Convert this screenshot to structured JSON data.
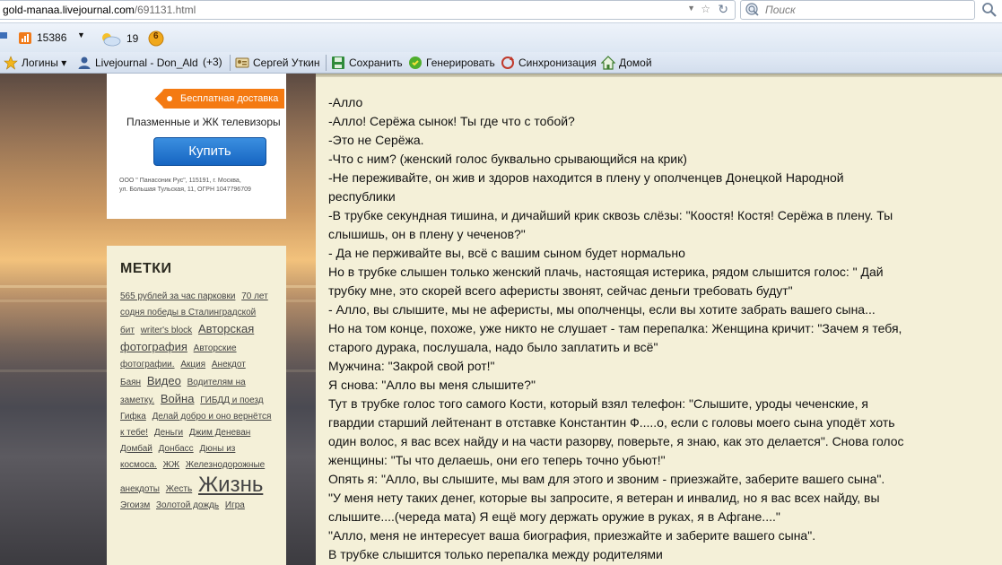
{
  "browser": {
    "url_host": "gold-manaa.livejournal.com",
    "url_path": "/691131.html",
    "search_placeholder": "Поиск"
  },
  "addons": {
    "rating": "15386",
    "weather": "19",
    "badge": "6"
  },
  "bookmarks": [
    {
      "label": "Логины ▾",
      "icon": "star-icon"
    },
    {
      "label": "Livejournal - Don_Ald",
      "icon": "user-icon"
    },
    {
      "label": "(+3)",
      "icon": ""
    },
    {
      "label": "Сергей Уткин",
      "icon": "id-card-icon"
    },
    {
      "label": "Сохранить",
      "icon": "save-icon"
    },
    {
      "label": "Генерировать",
      "icon": "generate-icon"
    },
    {
      "label": "Синхронизация",
      "icon": "sync-icon"
    },
    {
      "label": "Домой",
      "icon": "home-icon"
    }
  ],
  "ad": {
    "shipping": "Бесплатная доставка",
    "title": "Плазменные и ЖК телевизоры",
    "buy": "Купить",
    "fine_line1": "ООО \" Панасоник Рус\", 115191, г. Москва,",
    "fine_line2": "ул. Большая Тульская, 11, ОГРН 1047796709"
  },
  "tags": {
    "heading": "МЕТКИ",
    "items": [
      {
        "label": "565 рублей за час парковки",
        "size": 1
      },
      {
        "label": "70 лет содня победы в Сталинградской бит",
        "size": 1
      },
      {
        "label": "writer's block",
        "size": 1
      },
      {
        "label": "Авторская фотография",
        "size": 3
      },
      {
        "label": "Авторские фотографии.",
        "size": 1
      },
      {
        "label": "Акция",
        "size": 1
      },
      {
        "label": "Анекдот",
        "size": 1
      },
      {
        "label": "Баян",
        "size": 1
      },
      {
        "label": "Видео",
        "size": 3
      },
      {
        "label": "Водителям на заметку.",
        "size": 1
      },
      {
        "label": "Война",
        "size": 3
      },
      {
        "label": "ГИБДД и поезд",
        "size": 1
      },
      {
        "label": "Гифка",
        "size": 1
      },
      {
        "label": "Делай добро и оно вернётся к тебе!",
        "size": 1
      },
      {
        "label": "Деньги",
        "size": 1
      },
      {
        "label": "Джим Деневан",
        "size": 1
      },
      {
        "label": "Домбай",
        "size": 1
      },
      {
        "label": "Донбасс",
        "size": 1
      },
      {
        "label": "Дюны из космоса.",
        "size": 1
      },
      {
        "label": "ЖЖ",
        "size": 1
      },
      {
        "label": "Железнодорожные анекдоты",
        "size": 1
      },
      {
        "label": "Жесть",
        "size": 1
      },
      {
        "label": "Жизнь",
        "size": 4
      },
      {
        "label": "Эгоизм",
        "size": 1
      },
      {
        "label": "Золотой дождь",
        "size": 1
      },
      {
        "label": "Игра",
        "size": 1
      }
    ]
  },
  "article": {
    "lines": [
      "-Алло",
      "-Алло! Серёжа сынок! Ты где что с тобой?",
      "-Это не Серёжа.",
      "-Что с ним? (женский голос буквально срывающийся на крик)",
      "-Не переживайте, он жив  и здоров находится в плену у ополченцев Донецкой Народной",
      "республики",
      "-В трубке секундная тишина, и дичайший крик сквозь слёзы: \"Коостя! Костя! Серёжа в плену. Ты",
      "слышишь, он в плену у чеченов?\"",
      "- Да не перживайте вы, всё с вашим сыном будет нормально",
      "Но в трубке слышен только женский плачь, настоящая истерика, рядом слышится голос: \" Дай",
      "трубку мне, это скорей всего аферисты звонят, сейчас деньги требовать будут\"",
      "- Алло, вы слышите, мы не аферисты, мы ополченцы, если вы хотите забрать вашего сына...",
      "Но на том конце, похоже, уже никто не слушает - там перепалка: Женщина кричит: \"Зачем я тебя,",
      "старого дурака, послушала, надо было заплатить и всё\"",
      "Мужчина: \"Закрой свой рот!\"",
      "Я снова: \"Алло вы меня слышите?\"",
      "Тут в трубке голос того самого Кости, который взял телефон: \"Слышите, уроды чеченские, я",
      "гвардии старший лейтенант в отставке Константин Ф.....о, если с головы моего сына уподёт хоть",
      "один волос, я вас всех найду и на части разорву, поверьте, я знаю, как это делается\". Снова голос",
      "женщины: \"Ты что делаешь, они его теперь точно убьют!\"",
      "Опять я: \"Алло, вы слышите, мы вам для этого и звоним - приезжайте, заберите вашего сына\".",
      "\"У меня нету таких денег, которые вы запросите, я ветеран и инвалид, но я вас всех найду, вы",
      "слышите....(череда мата) Я ещё могу держать оружие в руках, я в Афгане....\"",
      "\"Алло, меня не интересует ваша биография, приезжайте и заберите вашего сына\".",
      "В трубке слышится только перепалка между родителями"
    ]
  }
}
